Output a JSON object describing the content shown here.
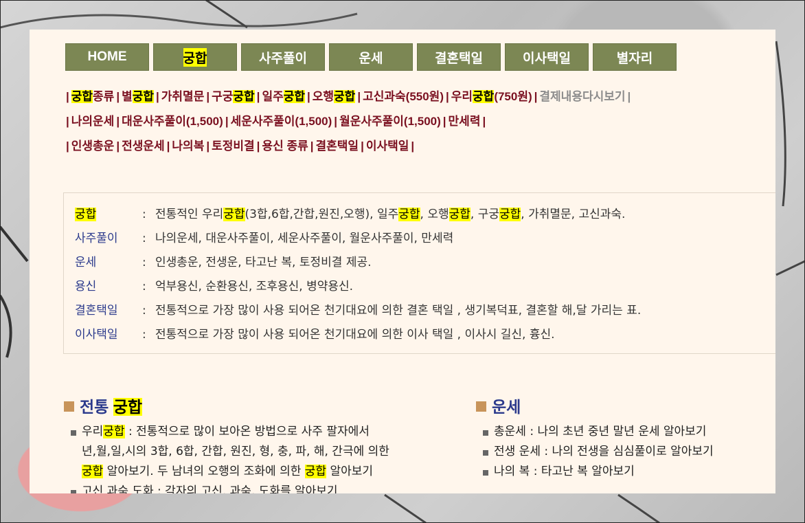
{
  "nav": [
    "HOME",
    "궁합",
    "사주풀이",
    "운세",
    "결혼택일",
    "이사택일",
    "별자리"
  ],
  "nav_highlight": "궁합",
  "links": {
    "row1": [
      {
        "parts": [
          {
            "t": "궁합",
            "hl": true
          },
          {
            "t": "종류"
          }
        ]
      },
      {
        "parts": [
          {
            "t": "별"
          },
          {
            "t": "궁합",
            "hl": true
          }
        ]
      },
      {
        "parts": [
          {
            "t": "가취멸문"
          }
        ]
      },
      {
        "parts": [
          {
            "t": "구궁"
          },
          {
            "t": "궁합",
            "hl": true
          }
        ]
      },
      {
        "parts": [
          {
            "t": "일주"
          },
          {
            "t": "궁합",
            "hl": true
          }
        ]
      },
      {
        "parts": [
          {
            "t": "오행"
          },
          {
            "t": "궁합",
            "hl": true
          }
        ]
      },
      {
        "parts": [
          {
            "t": "고신과숙(550원)"
          }
        ]
      },
      {
        "parts": [
          {
            "t": "우리"
          },
          {
            "t": "궁합",
            "hl": true
          },
          {
            "t": "(750원)"
          }
        ]
      },
      {
        "parts": [
          {
            "t": "결제내용다시보기"
          }
        ],
        "gray": true
      }
    ],
    "row2": [
      "나의운세",
      "대운사주풀이(1,500)",
      "세운사주풀이(1,500)",
      "월운사주풀이(1,500)",
      "만세력"
    ],
    "row3": [
      "인생총운",
      "전생운세",
      "나의복",
      "토정비결",
      "용신 종류",
      "결혼택일",
      "이사택일"
    ]
  },
  "info": [
    {
      "term": "궁합",
      "desc": [
        {
          "t": "전통적인 우리"
        },
        {
          "t": "궁합",
          "hl": true
        },
        {
          "t": "(3합,6합,간합,원진,오행), 일주"
        },
        {
          "t": "궁합",
          "hl": true
        },
        {
          "t": ", 오행"
        },
        {
          "t": "궁합",
          "hl": true
        },
        {
          "t": ", 구궁"
        },
        {
          "t": "궁합",
          "hl": true
        },
        {
          "t": ", 가취멸문, 고신과숙."
        }
      ]
    },
    {
      "term": "사주풀이",
      "desc": [
        {
          "t": " 나의운세, 대운사주풀이, 세운사주풀이, 월운사주풀이, 만세력"
        }
      ]
    },
    {
      "term": "운세",
      "desc": [
        {
          "t": "인생총운, 전생운, 타고난 복, 토정비결 제공."
        }
      ]
    },
    {
      "term": "용신",
      "desc": [
        {
          "t": "억부용신, 순환용신, 조후용신, 병약용신."
        }
      ]
    },
    {
      "term": "결혼택일",
      "desc": [
        {
          "t": "전통적으로 가장 많이 사용 되어온 천기대요에 의한 결혼 택일 ,    생기복덕표, 결혼할 해,달 가리는 표."
        }
      ]
    },
    {
      "term": "이사택일",
      "desc": [
        {
          "t": "전통적으로 가장 많이 사용 되어온 천기대요에 의한 이사 택일 ,    이사시 길신, 흉신."
        }
      ]
    }
  ],
  "info_colon": ":",
  "sections": {
    "left": {
      "title_prefix": "전통",
      "title_hl": "궁합",
      "lines": [
        {
          "bullet": true,
          "parts": [
            {
              "t": "우리"
            },
            {
              "t": "궁합",
              "hl": true
            },
            {
              "t": " : 전통적으로 많이 보아온 방법으로 사주 팔자에서"
            }
          ]
        },
        {
          "bullet": false,
          "parts": [
            {
              "t": "년,월,일,시의 3합, 6합, 간합, 원진, 형, 충, 파, 해, 간극에 의한"
            }
          ]
        },
        {
          "bullet": false,
          "parts": [
            {
              "t": "궁합",
              "hl": true
            },
            {
              "t": " 알아보기. 두 남녀의 오행의 조화에 의한 "
            },
            {
              "t": "궁합",
              "hl": true
            },
            {
              "t": " 알아보기"
            }
          ]
        },
        {
          "bullet": true,
          "parts": [
            {
              "t": "고신 과숙 도화 :  각자의 고신, 과숙, 도화를 알아보기"
            }
          ]
        }
      ]
    },
    "right": {
      "title": "운세",
      "lines": [
        "총운세 : 나의 초년 중년 말년 운세 알아보기",
        "전생 운세 : 나의 전생을 심심풀이로 알아보기",
        "나의 복 : 타고난 복 알아보기"
      ]
    }
  }
}
